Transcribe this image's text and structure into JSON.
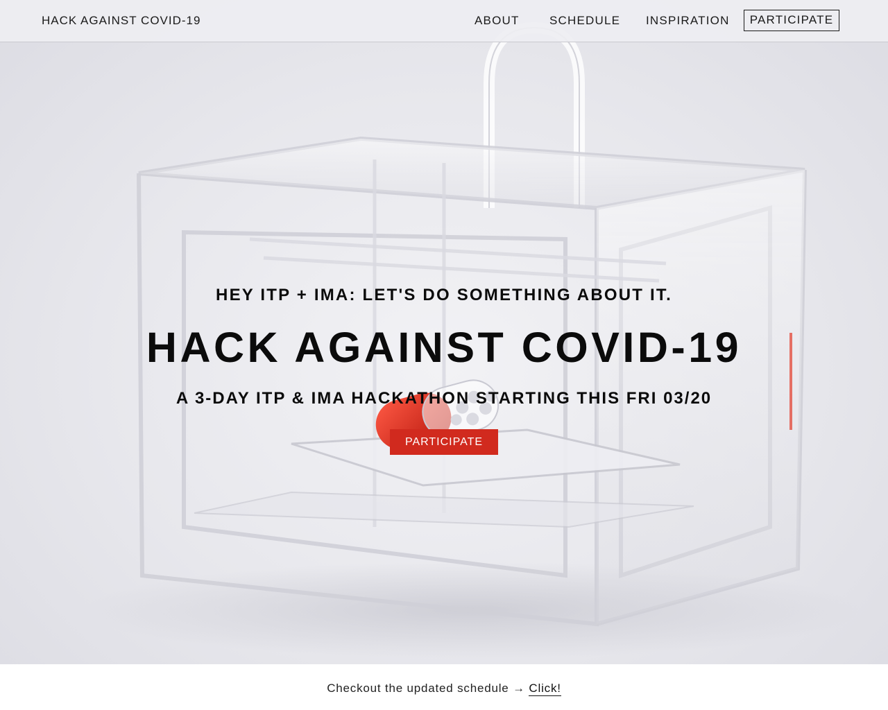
{
  "brand": {
    "title": "HACK AGAINST COVID-19"
  },
  "nav": {
    "about": "ABOUT",
    "schedule": "SCHEDULE",
    "inspiration": "INSPIRATION",
    "participate": "PARTICIPATE"
  },
  "hero": {
    "kicker": "HEY ITP + IMA: LET'S DO SOMETHING ABOUT IT.",
    "headline": "HACK AGAINST COVID-19",
    "subhead": "A 3-DAY ITP & IMA HACKATHON STARTING THIS FRI 03/20",
    "cta": "PARTICIPATE",
    "image_subject": "clear acrylic 3D printer with a red capsule pill"
  },
  "banner": {
    "text": "Checkout the updated schedule",
    "arrow": "→",
    "link": "Click!"
  },
  "colors": {
    "accent": "#d12a1e",
    "text": "#111111",
    "topbar": "#eeeef2"
  }
}
